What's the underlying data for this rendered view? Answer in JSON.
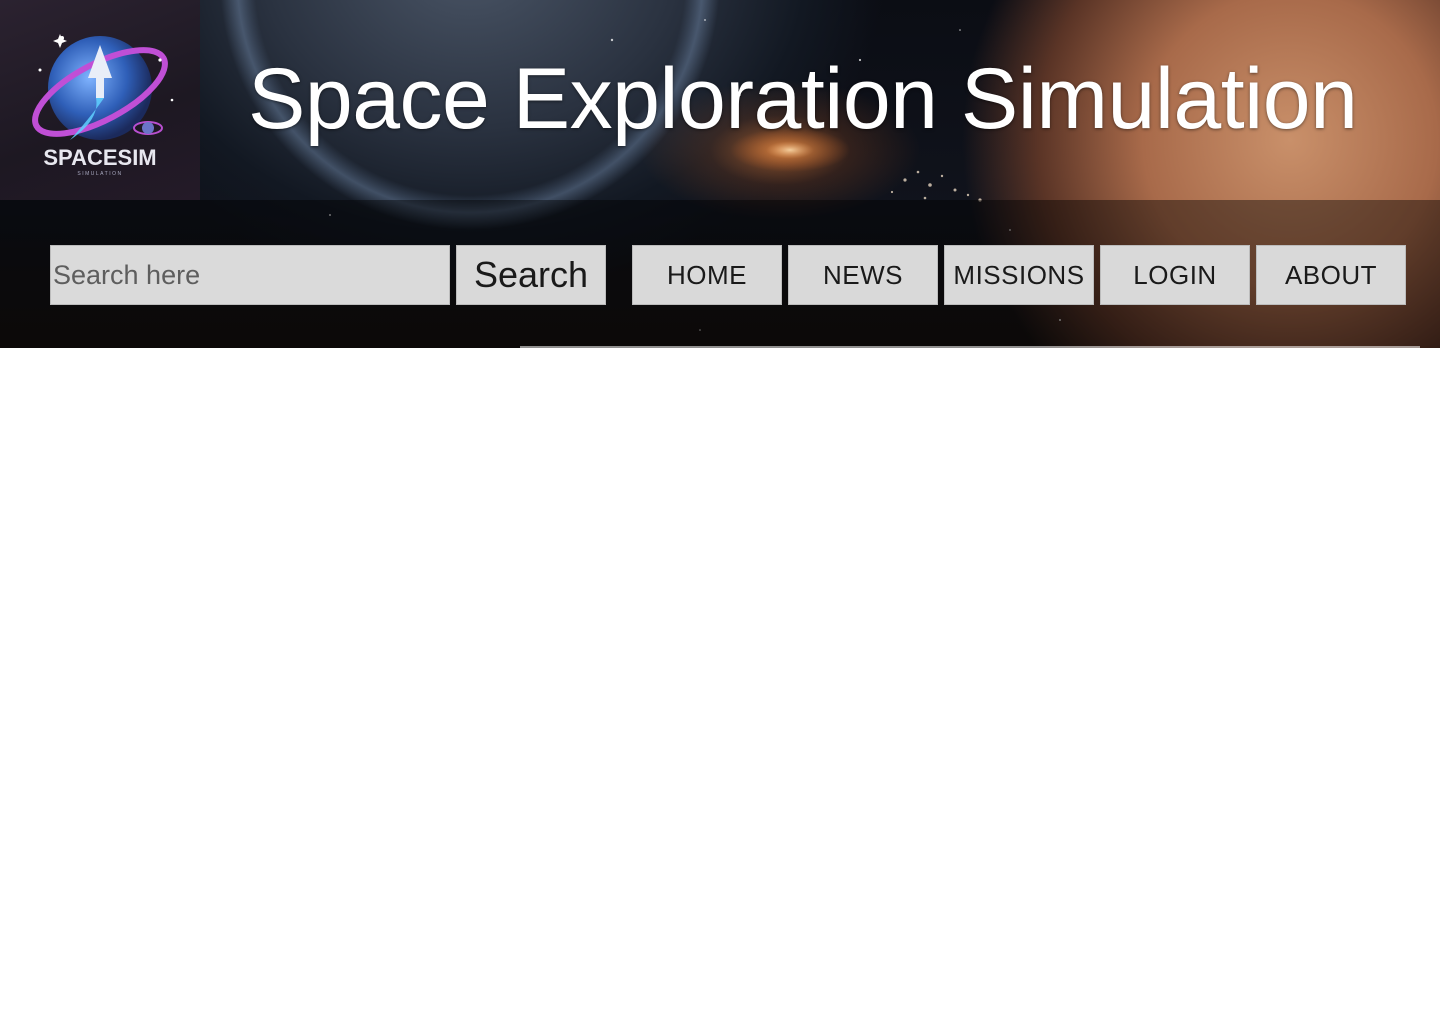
{
  "header": {
    "logo": {
      "text": "SPACESIM",
      "subtext": "SIMULATION",
      "icon": "rocket-planet-logo-icon"
    },
    "title": "Space Exploration Simulation"
  },
  "search": {
    "placeholder": "Search here",
    "value": "",
    "button_label": "Search"
  },
  "nav": {
    "items": [
      {
        "label": "HOME"
      },
      {
        "label": "NEWS"
      },
      {
        "label": "MISSIONS"
      },
      {
        "label": "LOGIN"
      },
      {
        "label": "ABOUT"
      }
    ]
  },
  "colors": {
    "button_bg": "#d9d9d9",
    "title_text": "#ffffff",
    "page_bg": "#ffffff"
  }
}
